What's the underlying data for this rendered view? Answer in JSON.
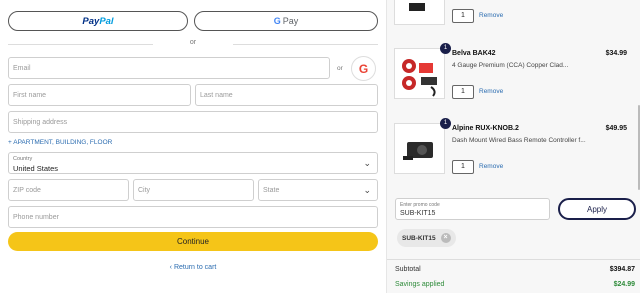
{
  "payments": {
    "paypal_part1": "Pay",
    "paypal_part2": "Pal",
    "gpay_g": "G",
    "gpay_label": "Pay"
  },
  "divider_or": "or",
  "form": {
    "email_placeholder": "Email",
    "or_small": "or",
    "google_letter": "G",
    "first_name_placeholder": "First name",
    "last_name_placeholder": "Last name",
    "shipping_placeholder": "Shipping address",
    "apartment_link": "+ APARTMENT, BUILDING, FLOOR",
    "country_label": "Country",
    "country_value": "United States",
    "zip_placeholder": "ZIP code",
    "city_placeholder": "City",
    "state_placeholder": "State",
    "phone_placeholder": "Phone number",
    "continue_label": "Continue",
    "return_label": "Return to cart",
    "return_chevron": "‹"
  },
  "cart": {
    "items": [
      {
        "name": "",
        "price": "",
        "desc": "",
        "qty": "1",
        "remove": "Remove",
        "badge": ""
      },
      {
        "name": "Belva BAK42",
        "price": "$34.99",
        "desc": "4 Gauge Premium (CCA) Copper Clad...",
        "qty": "1",
        "remove": "Remove",
        "badge": "1"
      },
      {
        "name": "Alpine RUX-KNOB.2",
        "price": "$49.95",
        "desc": "Dash Mount Wired Bass Remote Controller f...",
        "qty": "1",
        "remove": "Remove",
        "badge": "1"
      }
    ],
    "promo_label": "Enter promo code",
    "promo_value": "SUB-KIT15",
    "apply_label": "Apply",
    "applied_code": "SUB-KIT15",
    "chip_remove": "×"
  },
  "summary": {
    "subtotal_label": "Subtotal",
    "subtotal_value": "$394.87",
    "savings_label": "Savings applied",
    "savings_value": "$24.99"
  },
  "colors": {
    "accent_yellow": "#f5c518",
    "navy": "#1a1f4a",
    "link_blue": "#2b6cb0",
    "savings_green": "#2e8b3a"
  }
}
